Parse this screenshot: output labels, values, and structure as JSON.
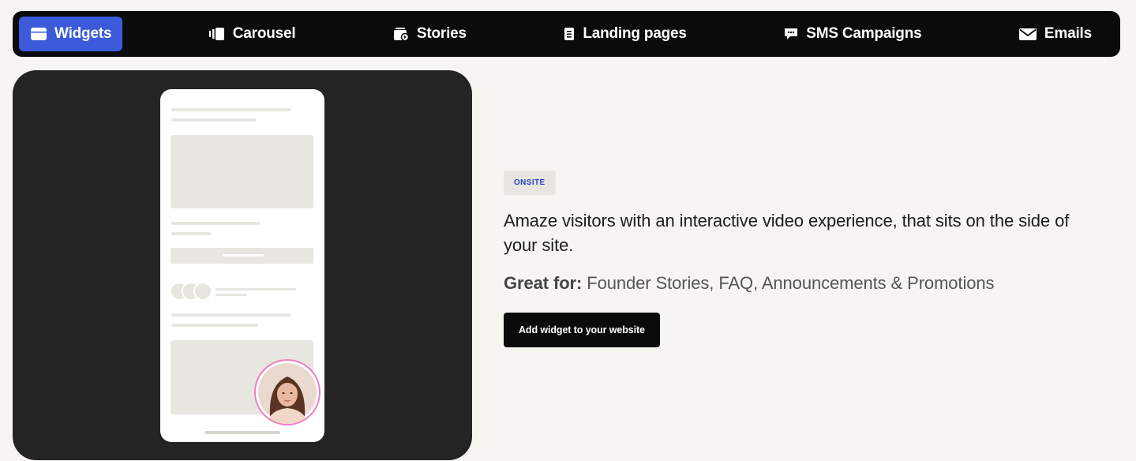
{
  "nav": {
    "tabs": [
      {
        "label": "Widgets",
        "icon": "browser-window-icon",
        "active": true
      },
      {
        "label": "Carousel",
        "icon": "carousel-icon",
        "active": false
      },
      {
        "label": "Stories",
        "icon": "stories-icon",
        "active": false
      },
      {
        "label": "Landing pages",
        "icon": "document-icon",
        "active": false
      },
      {
        "label": "SMS Campaigns",
        "icon": "chat-bubble-icon",
        "active": false
      },
      {
        "label": "Emails",
        "icon": "envelope-icon",
        "active": false
      }
    ]
  },
  "main": {
    "badge": "ONSITE",
    "headline": "Amaze visitors with an interactive video experience, that sits on the side of your site.",
    "great_for_label": "Great for:",
    "great_for_value": "Founder Stories, FAQ, Announcements & Promotions",
    "cta_label": "Add widget to your website"
  },
  "colors": {
    "page_bg": "#f6f5f1",
    "nav_bg": "#0b0b0b",
    "active_tab": "#3b5bdb",
    "hero_bg": "#242424",
    "badge_text": "#2941c9",
    "avatar_ring": "#f07fc1"
  }
}
